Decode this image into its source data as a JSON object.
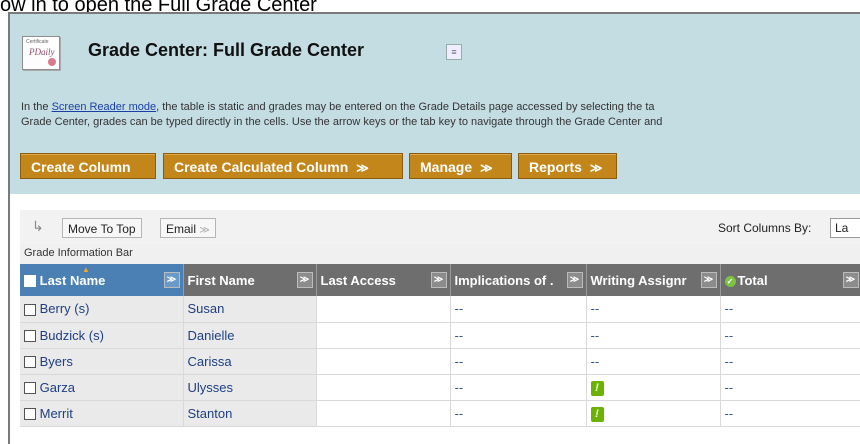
{
  "top_cut_text": "ow in to open the Full Grade Center",
  "page": {
    "title": "Grade Center: Full Grade Center",
    "description_prefix": "In the ",
    "description_link": "Screen Reader mode",
    "description_line1_rest": ", the table is static and grades may be entered on the Grade Details page accessed by selecting the ta",
    "description_line2": "Grade Center, grades can be typed directly in the cells. Use the arrow keys or the tab key to navigate through the Grade Center and"
  },
  "action_bar": {
    "create_column": "Create Column",
    "create_calculated_column": "Create Calculated Column",
    "manage": "Manage",
    "reports": "Reports"
  },
  "toolbar": {
    "move_to_top": "Move To Top",
    "email": "Email",
    "sort_columns_by_label": "Sort Columns By:",
    "sort_columns_by_value": "La"
  },
  "grade_information_bar": "Grade Information Bar",
  "table": {
    "columns": [
      "Last Name",
      "First Name",
      "Last Access",
      "Implications of .",
      "Writing Assignr",
      "Total"
    ],
    "rows": [
      {
        "last": "Berry (s)",
        "first": "Susan",
        "last_access": "",
        "implications": "--",
        "writing": "--",
        "total": "--"
      },
      {
        "last": "Budzick (s)",
        "first": "Danielle",
        "last_access": "",
        "implications": "--",
        "writing": "--",
        "total": "--"
      },
      {
        "last": "Byers",
        "first": "Carissa",
        "last_access": "",
        "implications": "--",
        "writing": "--",
        "total": "--"
      },
      {
        "last": "Garza",
        "first": "Ulysses",
        "last_access": "",
        "implications": "--",
        "writing": "needs-grading-icon",
        "total": "--"
      },
      {
        "last": "Merrit",
        "first": "Stanton",
        "last_access": "",
        "implications": "--",
        "writing": "needs-grading-icon",
        "total": "--"
      }
    ]
  },
  "colors": {
    "header_bg": "#c4dde3",
    "action_button": "#c2861a",
    "column_header": "#6e6e6e",
    "sorted_header": "#4a80b4",
    "needs_grading": "#6bb300"
  }
}
